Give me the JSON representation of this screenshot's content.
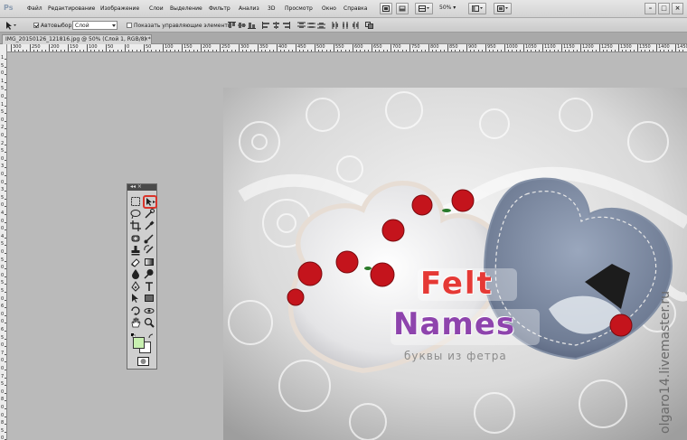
{
  "app": {
    "logo": "Ps"
  },
  "menus": [
    "Файл",
    "Редактирование",
    "Изображение",
    "Слои",
    "Выделение",
    "Фильтр",
    "Анализ",
    "3D",
    "Просмотр",
    "Окно",
    "Справка"
  ],
  "menubar": {
    "zoom": "50%",
    "zoom_icon": "chevron-down-icon"
  },
  "options_bar": {
    "auto_select_label": "Автовыбор:",
    "auto_select_checked": true,
    "auto_select_value": "Слой",
    "show_controls_label": "Показать управляющие элементы",
    "show_controls_checked": false
  },
  "document_tab": {
    "title": "IMG_20150126_121816.jpg @ 50% (Слой 1, RGB/8) *",
    "close": "×"
  },
  "ruler_labels": {
    "horizontal": [
      "300",
      "250",
      "200",
      "150",
      "100",
      "50",
      "0",
      "50",
      "100",
      "150",
      "200",
      "250",
      "300",
      "350",
      "400",
      "450",
      "500",
      "550",
      "600",
      "650",
      "700",
      "750",
      "800",
      "850",
      "900",
      "950",
      "1000",
      "1050",
      "1100",
      "1150",
      "1200",
      "1250",
      "1300",
      "1350",
      "1400",
      "1450"
    ],
    "vertical": [
      "1",
      "5",
      "0",
      "1",
      "5",
      "0",
      "1",
      "5",
      "0",
      "2",
      "0",
      "2",
      "5",
      "0",
      "3",
      "0",
      "0",
      "3",
      "5",
      "0",
      "4",
      "0",
      "0",
      "4",
      "5",
      "0",
      "5",
      "0",
      "0",
      "5",
      "5",
      "0",
      "6",
      "0",
      "0",
      "6",
      "5",
      "0",
      "7",
      "0",
      "0",
      "7",
      "5",
      "0",
      "8",
      "0",
      "0",
      "8",
      "5",
      "0"
    ]
  },
  "toolbox": {
    "title_controls": "◂◂ ×",
    "colors": {
      "foreground": "#c8f0b0",
      "background": "#ffffff"
    }
  },
  "photo": {
    "logo_line1": "Felt",
    "logo_line2": "Names",
    "subtitle": "буквы из фетра",
    "watermark": "olgaro14.livemaster.ru"
  }
}
